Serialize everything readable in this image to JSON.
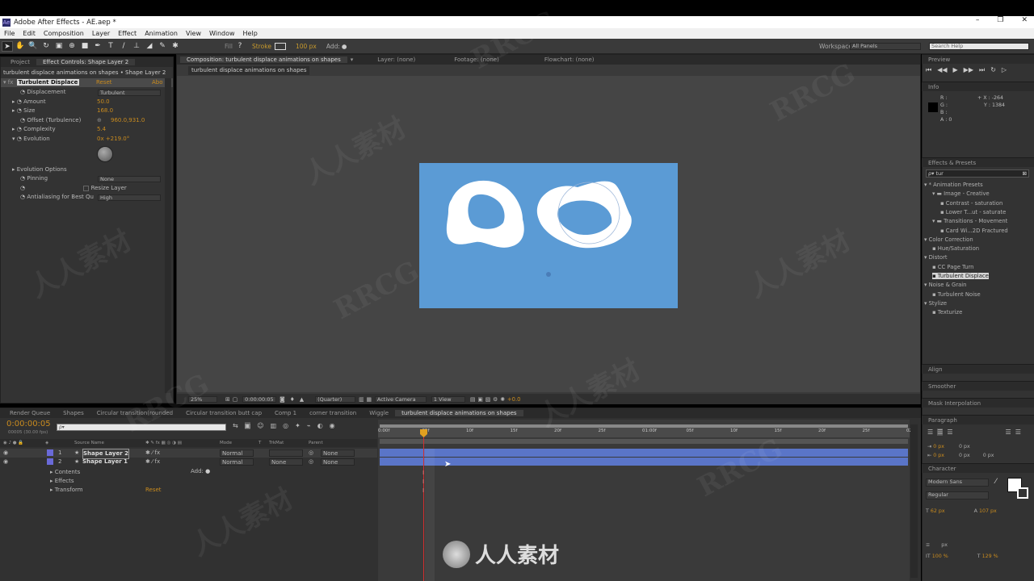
{
  "window": {
    "title": "Adobe After Effects - AE.aep *",
    "app_icon": "Ae",
    "controls": [
      "–",
      "❐",
      "✕"
    ]
  },
  "menu": [
    "File",
    "Edit",
    "Composition",
    "Layer",
    "Effect",
    "Animation",
    "View",
    "Window",
    "Help"
  ],
  "toolbar": {
    "fill_label": "Fill",
    "stroke_label": "Stroke",
    "stroke_px": "100 px",
    "add_label": "Add:",
    "workspace_label": "Workspace:",
    "workspace_value": "All Panels",
    "search_placeholder": "Search Help"
  },
  "project_panel": {
    "tabs": [
      "Project",
      "Effect Controls: Shape Layer 2"
    ],
    "breadcrumb": "turbulent displace animations on shapes • Shape Layer 2",
    "effect_name": "Turbulent Displace",
    "reset": "Reset",
    "about": "Abo",
    "properties": [
      {
        "label": "Displacement",
        "value": "Turbulent",
        "type": "dropdown"
      },
      {
        "label": "Amount",
        "value": "50.0",
        "type": "value"
      },
      {
        "label": "Size",
        "value": "168.0",
        "type": "value"
      },
      {
        "label": "Offset (Turbulence)",
        "value": "960.0,931.0",
        "type": "point"
      },
      {
        "label": "Complexity",
        "value": "5.4",
        "type": "value"
      },
      {
        "label": "Evolution",
        "value": "0x +219.0°",
        "type": "value"
      }
    ],
    "evolution_options": "Evolution Options",
    "pinning_label": "Pinning",
    "pinning_value": "None",
    "resize_layer": "Resize Layer",
    "antialias_label": "Antialiasing for Best Qu",
    "antialias_value": "High"
  },
  "comp_panel": {
    "tabs": [
      "Composition: turbulent displace animations on shapes",
      "Layer: (none)",
      "Footage: (none)",
      "Flowchart: (none)"
    ],
    "breadcrumb": "turbulent displace animations on shapes",
    "zoom": "25%",
    "timecode": "0:00:00:05",
    "resolution": "(Quarter)",
    "camera": "Active Camera",
    "view": "1 View",
    "exposure": "+0.0"
  },
  "timeline": {
    "tabs": [
      "Render Queue",
      "Shapes",
      "Circular transition(rounded",
      "Circular transition butt cap",
      "Comp 1",
      "corner transition",
      "Wiggle",
      "turbulent displace animations on shapes"
    ],
    "timecode": "0:00:00:05",
    "frame_info": "00005 (30.00 fps)",
    "search_placeholder": "ρ▾",
    "columns": [
      "Source Name",
      "Mode",
      "T",
      "TrkMat",
      "Parent"
    ],
    "layers": [
      {
        "num": "1",
        "name": "Shape Layer 2",
        "mode": "Normal",
        "trkmat": "",
        "parent": "None",
        "color": "#6a6ad8"
      },
      {
        "num": "2",
        "name": "Shape Layer 1",
        "mode": "Normal",
        "trkmat": "None",
        "parent": "None",
        "color": "#6a6ad8"
      }
    ],
    "add_label": "Add:",
    "sub_items": [
      "Contents",
      "Effects",
      "Transform"
    ],
    "transform_reset": "Reset",
    "ruler": [
      "0:00f",
      "05f",
      "10f",
      "15f",
      "20f",
      "25f",
      "01:00f",
      "05f",
      "10f",
      "15f",
      "20f",
      "25f",
      "02:0"
    ]
  },
  "right_panels": {
    "preview": "Preview",
    "info": "Info",
    "info_values": {
      "r": "R :",
      "g": "G :",
      "b": "B :",
      "a": "A : 0",
      "x": "X : -264",
      "y": "Y : 1384"
    },
    "effects_presets": "Effects & Presets",
    "search_value": "tur",
    "tree": [
      {
        "label": "* Animation Presets",
        "indent": 0,
        "sel": false
      },
      {
        "label": "Image - Creative",
        "indent": 1,
        "sel": false
      },
      {
        "label": "Contrast - saturation",
        "indent": 2,
        "sel": false
      },
      {
        "label": "Lower T...ut - saturate",
        "indent": 2,
        "sel": false
      },
      {
        "label": "Transitions - Movement",
        "indent": 1,
        "sel": false
      },
      {
        "label": "Card Wi...2D Fractured",
        "indent": 2,
        "sel": false
      },
      {
        "label": "Color Correction",
        "indent": 0,
        "sel": false
      },
      {
        "label": "Hue/Saturation",
        "indent": 1,
        "sel": false
      },
      {
        "label": "Distort",
        "indent": 0,
        "sel": false
      },
      {
        "label": "CC Page Turn",
        "indent": 1,
        "sel": false
      },
      {
        "label": "Turbulent Displace",
        "indent": 1,
        "sel": true
      },
      {
        "label": "Noise & Grain",
        "indent": 0,
        "sel": false
      },
      {
        "label": "Turbulent Noise",
        "indent": 1,
        "sel": false
      },
      {
        "label": "Stylize",
        "indent": 0,
        "sel": false
      },
      {
        "label": "Texturize",
        "indent": 1,
        "sel": false
      }
    ],
    "align": "Align",
    "smoother": "Smoother",
    "mask_interp": "Mask Interpolation",
    "paragraph": "Paragraph",
    "character": "Character",
    "font": "Modern Sans",
    "style": "Regular",
    "size": "62 px",
    "leading": "107 px",
    "px_labels": [
      "0 px",
      "0 px",
      "0 px",
      "0 px",
      "0 px",
      "px"
    ],
    "scale_v": "100 %",
    "scale_h": "129 %"
  },
  "watermark": {
    "text1": "RRCG",
    "text2": "人人素材"
  },
  "colors": {
    "comp_bg": "#5b9bd5",
    "track": "#5a75c8",
    "accent_orange": "#c98b1e",
    "cti": "#e0a020"
  }
}
